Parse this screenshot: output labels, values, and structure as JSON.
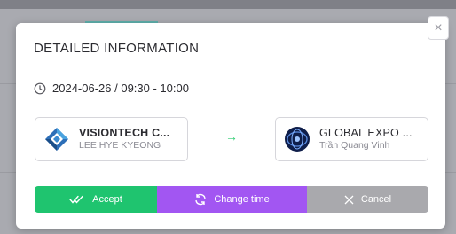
{
  "modal": {
    "title": "DETAILED INFORMATION",
    "close_label": "×",
    "datetime": "2024-06-26 / 09:30 - 10:00"
  },
  "from_party": {
    "company": "VISIONTECH C...",
    "person": "LEE HYE KYEONG",
    "logo_icon": "visiontech-logo-icon"
  },
  "arrow": "→",
  "to_party": {
    "company": "GLOBAL EXPO ...",
    "person": "Trần Quang Vinh",
    "logo_icon": "global-expo-logo-icon"
  },
  "actions": {
    "accept": "Accept",
    "change_time": "Change time",
    "cancel": "Cancel"
  },
  "colors": {
    "accept": "#1fc46f",
    "change_time": "#a256f2",
    "cancel": "#a9a9ad",
    "arrow": "#2ecc71"
  }
}
